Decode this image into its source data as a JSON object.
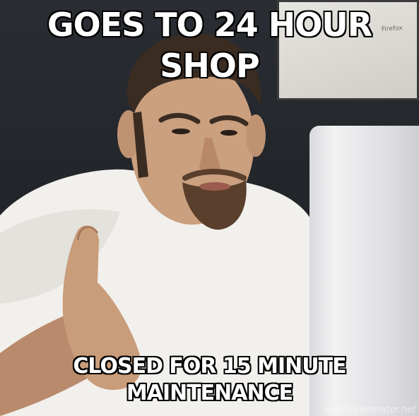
{
  "meme": {
    "top_text": [
      "GOES TO 24 HOUR",
      "SHOP"
    ],
    "bottom_text": [
      "CLOSED FOR 15 MINUTE",
      "MAINTENANCE"
    ],
    "poster_text": "Firefox",
    "watermark": "memegenerator.net"
  },
  "colors": {
    "caption_fill": "#ffffff",
    "caption_outline": "#000000",
    "shirt": "#f1f0ec",
    "skin": "#caa07f",
    "hair": "#3b2c22",
    "laptop": "#e6e7e9",
    "background": "#23262b"
  }
}
